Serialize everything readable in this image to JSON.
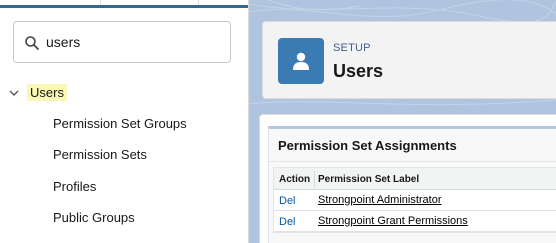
{
  "search": {
    "value": "users",
    "icon": "search-icon"
  },
  "tree": {
    "root_label": "Users",
    "items": [
      {
        "label": "Permission Set Groups"
      },
      {
        "label": "Permission Sets"
      },
      {
        "label": "Profiles"
      },
      {
        "label": "Public Groups"
      }
    ]
  },
  "header": {
    "eyebrow": "SETUP",
    "title": "Users",
    "icon": "user-icon",
    "icon_color": "#3a7bb4"
  },
  "permission_set_assignments": {
    "title": "Permission Set Assignments",
    "columns": {
      "action": "Action",
      "label": "Permission Set Label"
    },
    "rows": [
      {
        "action": "Del",
        "label": "Strongpoint Administrator"
      },
      {
        "action": "Del",
        "label": "Strongpoint Grant Permissions"
      }
    ]
  },
  "colors": {
    "highlight": "#fbf8b6",
    "link": "#015ba7",
    "background": "#b0c4df"
  }
}
